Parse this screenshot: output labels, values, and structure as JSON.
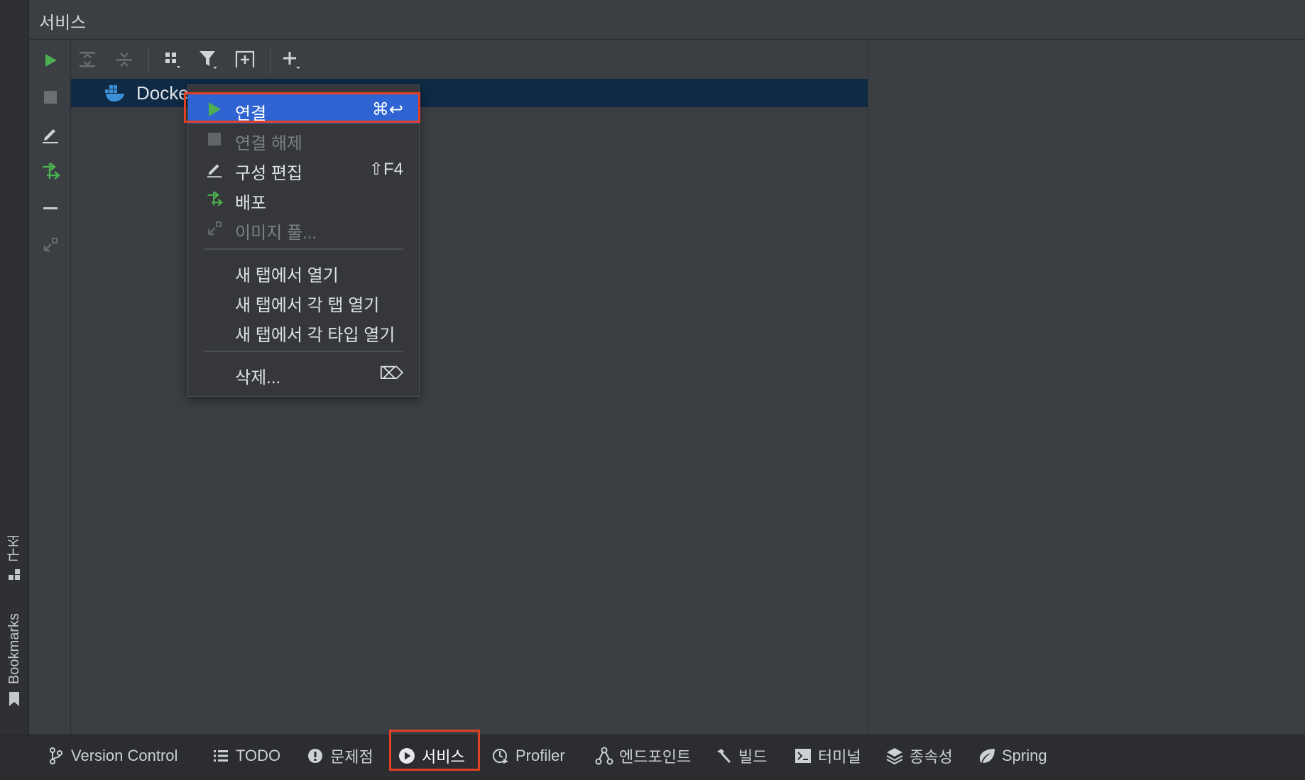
{
  "tool_window": {
    "title": "서비스"
  },
  "tree": {
    "items": [
      {
        "label": "Docker",
        "icon": "docker-icon"
      }
    ]
  },
  "toolbar": {
    "buttons": [
      "expand-all-icon",
      "collapse-all-icon",
      "group-by-icon",
      "filter-icon",
      "new-tab-icon",
      "add-icon"
    ]
  },
  "action_rail": {
    "buttons": [
      "run-icon",
      "stop-icon",
      "edit-icon",
      "deploy-icon",
      "minus-icon",
      "pull-image-icon"
    ]
  },
  "context_menu": {
    "items": [
      {
        "label": "연결",
        "shortcut": "⌘↩",
        "icon": "play-icon",
        "state": "selected"
      },
      {
        "label": "연결 해제",
        "shortcut": "",
        "icon": "stop-icon",
        "state": "disabled"
      },
      {
        "label": "구성 편집",
        "shortcut": "⇧F4",
        "icon": "edit-icon",
        "state": "enabled"
      },
      {
        "label": "배포",
        "shortcut": "",
        "icon": "deploy-icon",
        "state": "enabled"
      },
      {
        "label": "이미지 풀...",
        "shortcut": "",
        "icon": "pull-image-icon",
        "state": "disabled"
      },
      {
        "label": "새 탭에서 열기",
        "shortcut": "",
        "state": "enabled"
      },
      {
        "label": "새 탭에서 각 탭 열기",
        "shortcut": "",
        "state": "enabled"
      },
      {
        "label": "새 탭에서 각 타입 열기",
        "shortcut": "",
        "state": "enabled"
      },
      {
        "label": "삭제...",
        "shortcut": "⌦",
        "state": "enabled"
      }
    ]
  },
  "side_tabs": [
    {
      "label": "구조",
      "icon": "structure-icon"
    },
    {
      "label": "Bookmarks",
      "icon": "bookmark-icon"
    }
  ],
  "bottom_tabs": [
    {
      "label": "Version Control",
      "icon": "version-control-icon"
    },
    {
      "label": "TODO",
      "icon": "todo-list-icon"
    },
    {
      "label": "문제점",
      "icon": "problems-icon"
    },
    {
      "label": "서비스",
      "icon": "services-icon",
      "active": true
    },
    {
      "label": "Profiler",
      "icon": "profiler-icon"
    },
    {
      "label": "엔드포인트",
      "icon": "endpoints-icon"
    },
    {
      "label": "빌드",
      "icon": "hammer-icon"
    },
    {
      "label": "터미널",
      "icon": "terminal-icon"
    },
    {
      "label": "종속성",
      "icon": "dependencies-icon"
    },
    {
      "label": "Spring",
      "icon": "spring-leaf-icon"
    }
  ],
  "colors": {
    "accent_selected": "#2f64d2",
    "highlight_border": "#e04125",
    "run_green": "#4caf50",
    "tree_selection": "#0e2a44"
  }
}
